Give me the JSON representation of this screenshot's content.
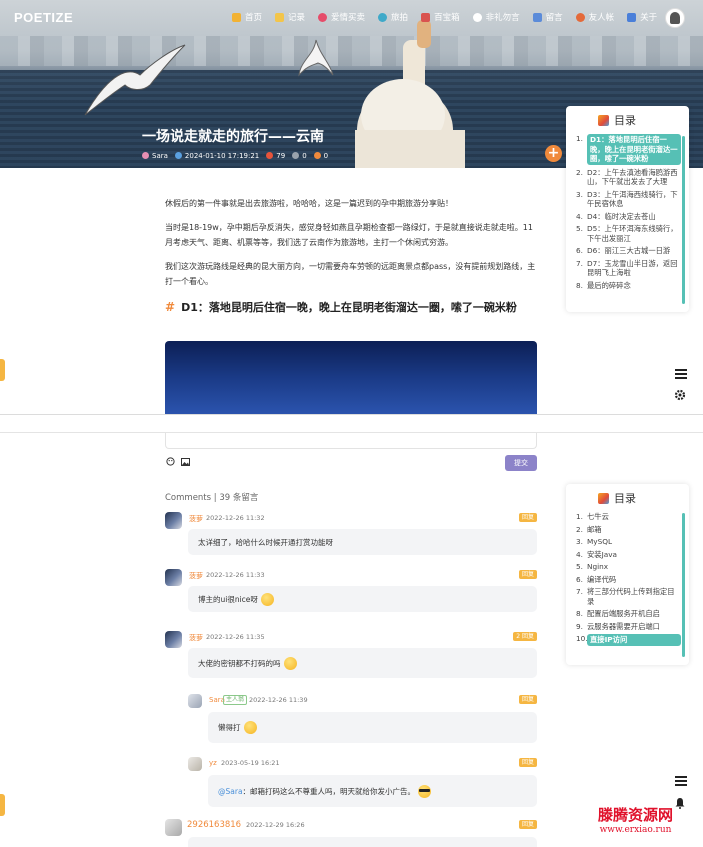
{
  "brand": {
    "logo": "POETIZE"
  },
  "nav": {
    "items": [
      {
        "label": "首页",
        "icon": "home-icon",
        "color": "#f2b233"
      },
      {
        "label": "记录",
        "icon": "notebook-icon",
        "color": "#f3c54a"
      },
      {
        "label": "爱情买卖",
        "icon": "heart-icon",
        "color": "#e64c6a"
      },
      {
        "label": "旅拍",
        "icon": "globe-icon",
        "color": "#3fa9c9"
      },
      {
        "label": "百宝箱",
        "icon": "treasure-box-icon",
        "color": "#d9534f"
      },
      {
        "label": "非礼勿言",
        "icon": "chat-icon",
        "color": "#ffffff"
      },
      {
        "label": "留言",
        "icon": "flag-icon",
        "color": "#5b8bd9"
      },
      {
        "label": "友人帐",
        "icon": "friends-icon",
        "color": "#e46a3a"
      },
      {
        "label": "关于",
        "icon": "info-icon",
        "color": "#4a7fd9"
      }
    ]
  },
  "post": {
    "title": "一场说走就走的旅行——云南",
    "author": "Sara",
    "date": "2024-01-10 17:19:21",
    "views": "79",
    "comments": "0",
    "likes": "0"
  },
  "article": {
    "paragraphs": [
      "休假后的第一件事就是出去旅游啦，哈哈哈，这是一篇迟到的孕中期旅游分享贴！",
      "当时是18-19w，孕中期后孕反消失，感觉身轻如燕且孕期检查都一路绿灯，于是就直接说走就走啦。11月考虑天气、距离、机票等等，我们选了云南作为旅游地，主打一个休闲式穷游。",
      "我们这次游玩路线是经典的昆大丽方向，一切需要舟车劳顿的远距离景点都pass，没有提前规划路线，主打一个看心。"
    ],
    "heading_hash": "#",
    "heading": "D1：落地昆明后住宿一晚，晚上在昆明老街溜达一圈，嗦了一碗米粉"
  },
  "toc1": {
    "title": "目录",
    "items": [
      {
        "num": "1.",
        "label": "D1：落地昆明后住宿一晚，晚上在昆明老街溜达一圈，嗦了一碗米粉",
        "active": true
      },
      {
        "num": "2.",
        "label": "D2：上午去滇池看海鸥游西山，下午就出发去了大理",
        "active": false
      },
      {
        "num": "3.",
        "label": "D3：上午洱海西线骑行，下午民宿休息",
        "active": false
      },
      {
        "num": "4.",
        "label": "D4：临时决定去苍山",
        "active": false
      },
      {
        "num": "5.",
        "label": "D5：上午环洱海东线骑行，下午出发丽江",
        "active": false
      },
      {
        "num": "6.",
        "label": "D6：丽江三大古城一日游",
        "active": false
      },
      {
        "num": "7.",
        "label": "D7：玉龙雪山半日游，返回昆明飞上海啦",
        "active": false
      },
      {
        "num": "8.",
        "label": "最后的碎碎念",
        "active": false
      }
    ]
  },
  "comment_form": {
    "submit": "提交"
  },
  "comments": {
    "header": "Comments | 39 条留言",
    "list": [
      {
        "name": "菠萝",
        "time": "2022-12-26 11:32",
        "reply": "回复",
        "text": "太详细了，哈哈什么时候开通打赏功能呀",
        "emoji": ""
      },
      {
        "name": "菠萝",
        "time": "2022-12-26 11:33",
        "reply": "回复",
        "text": "博主的ui很nice呀",
        "emoji": "grin-emoji"
      },
      {
        "name": "菠萝",
        "time": "2022-12-26 11:35",
        "reply": "2 回复",
        "text": "大佬的密钥都不打码的吗",
        "emoji": "thinking-emoji"
      },
      {
        "name": "Sara",
        "host": "主人翁",
        "time": "2022-12-26 11:39",
        "reply": "回复",
        "text": "懒得打",
        "emoji": "shrug-emoji"
      },
      {
        "name": "yz",
        "time": "2023-05-19 16:21",
        "reply": "回复",
        "at": "@Sara",
        "text": "：邮箱打码这么不尊重人吗，明天就给你发小广告。",
        "emoji": "sunglasses-emoji"
      },
      {
        "name": "2926163816",
        "time": "2022-12-29 16:26",
        "reply": "回复",
        "text": "",
        "emoji": ""
      }
    ]
  },
  "toc2": {
    "title": "目录",
    "items": [
      {
        "num": "1.",
        "label": "七牛云",
        "active": false
      },
      {
        "num": "2.",
        "label": "邮箱",
        "active": false
      },
      {
        "num": "3.",
        "label": "MySQL",
        "active": false
      },
      {
        "num": "4.",
        "label": "安装Java",
        "active": false
      },
      {
        "num": "5.",
        "label": "Nginx",
        "active": false
      },
      {
        "num": "6.",
        "label": "编译代码",
        "active": false
      },
      {
        "num": "7.",
        "label": "将三部分代码上传到指定目录",
        "active": false
      },
      {
        "num": "8.",
        "label": "配置后端服务开机自启",
        "active": false
      },
      {
        "num": "9.",
        "label": "云服务器需要开启端口",
        "active": false
      },
      {
        "num": "10.",
        "label": "直接IP访问",
        "active": true
      }
    ]
  },
  "watermark": {
    "title": "滕腾资源网",
    "url": "www.erxiao.run"
  },
  "colors": {
    "accent": "#f08a3c",
    "toc_active": "#56c0b5",
    "reply": "#f5b642",
    "submit": "#8c83c9"
  }
}
